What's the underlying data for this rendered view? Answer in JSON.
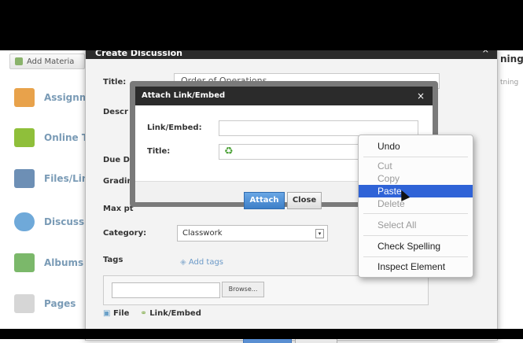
{
  "background": {
    "add_material_label": "Add Materia",
    "right_clip_text": "ning",
    "right_clip_sub": "tning",
    "sidebar": [
      {
        "label": "Assignm",
        "icon": "assignment-icon",
        "color": "#e8a24b"
      },
      {
        "label": "Online T",
        "icon": "online-test-icon",
        "color": "#8fbf3a"
      },
      {
        "label": "Files/Lin",
        "icon": "files-icon",
        "color": "#6d8fb5"
      },
      {
        "label": "Discuss",
        "icon": "discussion-icon",
        "color": "#6fa9d9"
      },
      {
        "label": "Albums",
        "icon": "albums-icon",
        "color": "#7bb86a"
      },
      {
        "label": "Pages",
        "icon": "pages-icon",
        "color": "#c9c9c9"
      }
    ]
  },
  "dialog": {
    "title": "Create Discussion",
    "close": "×",
    "title_label": "Title:",
    "title_value": "Order of Operations",
    "desc_label": "Descr",
    "due_label": "Due Da",
    "grading_label": "Gradin",
    "max_label": "Max pt",
    "category_label": "Category:",
    "category_value": "Classwork",
    "tags_label": "Tags",
    "add_tags": "Add tags",
    "browse": "Browse...",
    "file_link": "File",
    "link_embed_link": "Link/Embed"
  },
  "attach": {
    "title": "Attach Link/Embed",
    "close": "×",
    "link_label": "Link/Embed:",
    "title_label": "Title:",
    "attach_button": "Attach",
    "close_button": "Close"
  },
  "context_menu": {
    "items": [
      {
        "label": "Undo",
        "state": "enabled"
      },
      {
        "label": "Cut",
        "state": "disabled"
      },
      {
        "label": "Copy",
        "state": "disabled"
      },
      {
        "label": "Paste",
        "state": "highlighted"
      },
      {
        "label": "Delete",
        "state": "disabled"
      },
      {
        "label": "Select All",
        "state": "disabled"
      },
      {
        "label": "Check Spelling",
        "state": "enabled"
      },
      {
        "label": "Inspect Element",
        "state": "enabled"
      }
    ]
  }
}
